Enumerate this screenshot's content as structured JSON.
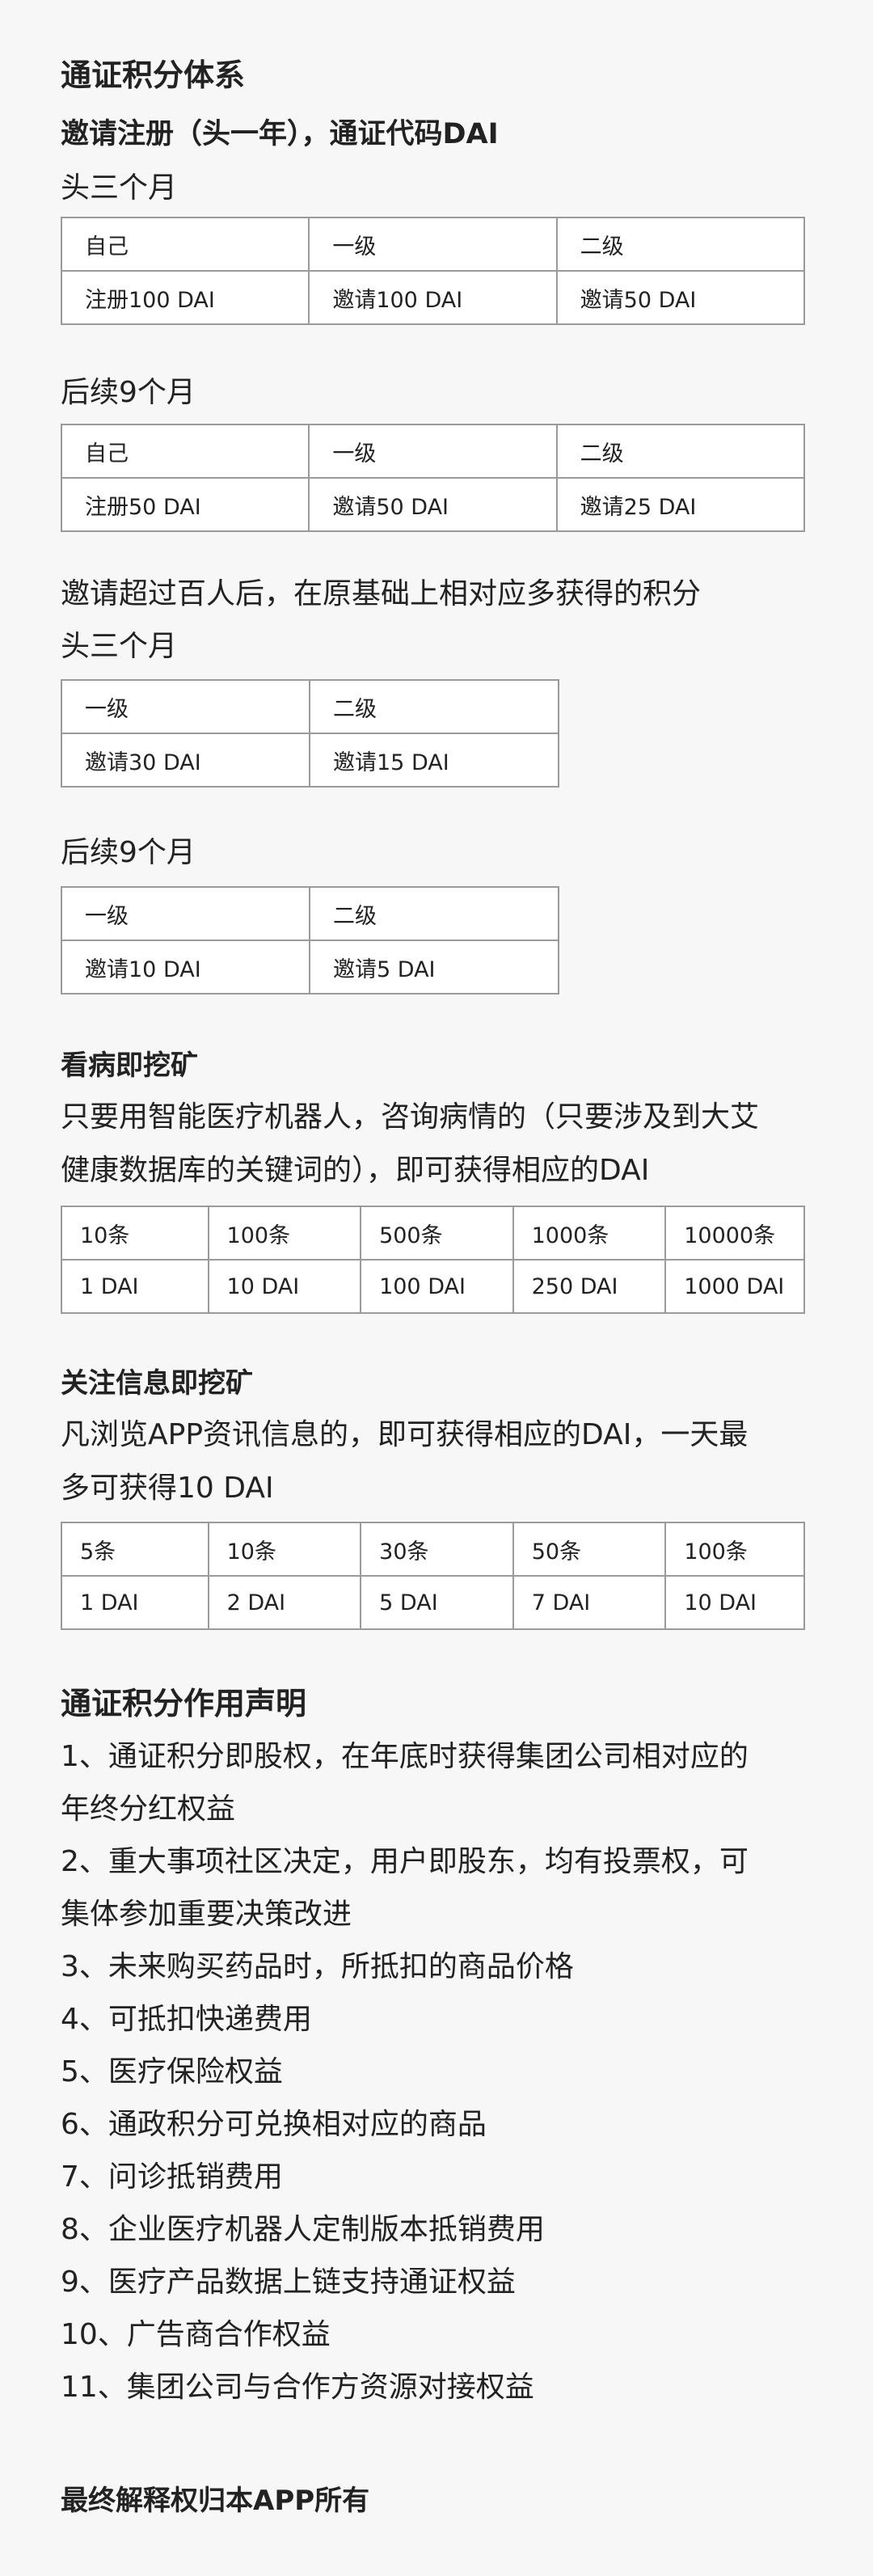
{
  "title": "通证积分体系",
  "invite_heading": "邀请注册（头一年），通证代码DAI",
  "first3_label": "头三个月",
  "first3_table": {
    "headers": [
      "自己",
      "一级",
      "二级"
    ],
    "row": [
      "注册100 DAI",
      "邀请100 DAI",
      "邀请50 DAI"
    ]
  },
  "next9_label": "后续9个月",
  "next9_table": {
    "headers": [
      "自己",
      "一级",
      "二级"
    ],
    "row": [
      "注册50 DAI",
      "邀请50 DAI",
      "邀请25 DAI"
    ]
  },
  "over100_text": "邀请超过百人后，在原基础上相对应多获得的积分",
  "over100_first3_label": "头三个月",
  "over100_first3_table": {
    "headers": [
      "一级",
      "二级"
    ],
    "row": [
      "邀请30 DAI",
      "邀请15 DAI"
    ]
  },
  "over100_next9_label": "后续9个月",
  "over100_next9_table": {
    "headers": [
      "一级",
      "二级"
    ],
    "row": [
      "邀请10 DAI",
      "邀请5 DAI"
    ]
  },
  "mining_heading": "看病即挖矿",
  "mining_text_1": "只要用智能医疗机器人，咨询病情的（只要涉及到大艾",
  "mining_text_2": "健康数据库的关键词的），即可获得相应的DAI",
  "mining_table": {
    "headers": [
      "10条",
      "100条",
      "500条",
      "1000条",
      "10000条"
    ],
    "row": [
      "1 DAI",
      "10 DAI",
      "100 DAI",
      "250 DAI",
      "1000 DAI"
    ]
  },
  "follow_heading": "关注信息即挖矿",
  "follow_text_1": "凡浏览APP资讯信息的，即可获得相应的DAI，一天最",
  "follow_text_2": "多可获得10 DAI",
  "follow_table": {
    "headers": [
      "5条",
      "10条",
      "30条",
      "50条",
      "100条"
    ],
    "row": [
      "1 DAI",
      "2 DAI",
      "5 DAI",
      "7 DAI",
      "10 DAI"
    ]
  },
  "statement_heading": "通证积分作用声明",
  "statement_items": [
    "1、通证积分即股权，在年底时获得集团公司相对应的",
    "年终分红权益",
    "2、重大事项社区决定，用户即股东，均有投票权，可",
    "集体参加重要决策改进",
    "3、未来购买药品时，所抵扣的商品价格",
    "4、可抵扣快递费用",
    "5、医疗保险权益",
    "6、通政积分可兑换相对应的商品",
    "7、问诊抵销费用",
    "8、企业医疗机器人定制版本抵销费用",
    "9、医疗产品数据上链支持通证权益",
    "10、广告商合作权益",
    "11、集团公司与合作方资源对接权益"
  ],
  "footer": "最终解释权归本APP所有"
}
